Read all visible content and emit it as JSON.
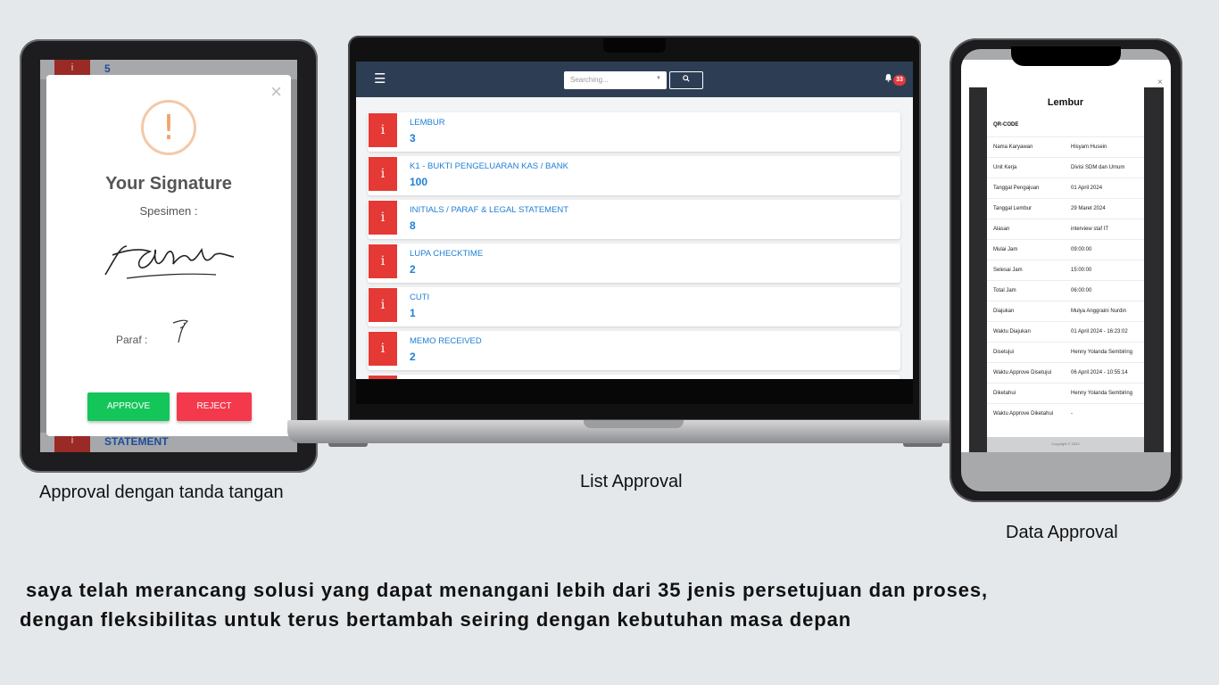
{
  "tablet": {
    "bg_rows": [
      {
        "icon": "i",
        "text": "5"
      },
      {
        "icon": "i",
        "text": "STATEMENT"
      }
    ],
    "modal": {
      "close": "×",
      "warning_icon": "!",
      "title": "Your Signature",
      "subtitle": "Spesimen :",
      "paraf_label": "Paraf :",
      "approve_label": "APPROVE",
      "reject_label": "REJECT"
    }
  },
  "laptop": {
    "menu_icon": "☰",
    "search_placeholder": "Searching...",
    "search_icon": "🔍",
    "notification_count": "33",
    "cards": [
      {
        "icon": "i",
        "label": "LEMBUR",
        "count": "3"
      },
      {
        "icon": "i",
        "label": "K1 - BUKTI PENGELUARAN KAS / BANK",
        "count": "100"
      },
      {
        "icon": "i",
        "label": "INITIALS / PARAF & LEGAL STATEMENT",
        "count": "8"
      },
      {
        "icon": "i",
        "label": "LUPA CHECKTIME",
        "count": "2"
      },
      {
        "icon": "i",
        "label": "CUTI",
        "count": "1"
      },
      {
        "icon": "i",
        "label": "MEMO RECEIVED",
        "count": "2"
      }
    ]
  },
  "phone": {
    "close": "×",
    "doc_title": "Lembur",
    "qr_label": "QR-CODE",
    "rows": [
      {
        "key": "Nama Karyawan",
        "value": "Hisyam Husein"
      },
      {
        "key": "Unit Kerja",
        "value": "Divisi SDM dan Umum"
      },
      {
        "key": "Tanggal Pengajuan",
        "value": "01 April 2024"
      },
      {
        "key": "Tanggal Lembur",
        "value": "29 Maret 2024"
      },
      {
        "key": "Alasan",
        "value": "interview staf IT"
      },
      {
        "key": "Mulai Jam",
        "value": "09:00:00"
      },
      {
        "key": "Selesai Jam",
        "value": "15:00:00"
      },
      {
        "key": "Total Jam",
        "value": "06:00:00"
      },
      {
        "key": "Diajukan",
        "value": "Mulya Anggraini Nurdin"
      },
      {
        "key": "Waktu Diajukan",
        "value": "01 April 2024 - 16:23:02"
      },
      {
        "key": "Disetujui",
        "value": "Henny Yolanda Sembiring"
      },
      {
        "key": "Waktu Approve Disetujui",
        "value": "06 April 2024 - 10:55:14"
      },
      {
        "key": "Diketahui",
        "value": "Henny Yolanda Sembiring"
      },
      {
        "key": "Waktu Approve Diketahui",
        "value": "-"
      }
    ],
    "footer": "Copyright © 2024"
  },
  "captions": {
    "left": "Approval dengan tanda tangan",
    "middle": "List Approval",
    "right": "Data Approval"
  },
  "paragraph": {
    "line1": " saya telah merancang solusi yang dapat menangani lebih dari 35 jenis persetujuan dan proses,",
    "line2": "dengan fleksibilitas untuk terus bertambah seiring dengan kebutuhan masa depan"
  },
  "colors": {
    "background": "#e5e8eb",
    "approve": "#14c65a",
    "reject": "#f4394c",
    "topbar": "#2d3e54",
    "card_icon": "#e53935",
    "link_blue": "#1e7fd6"
  }
}
